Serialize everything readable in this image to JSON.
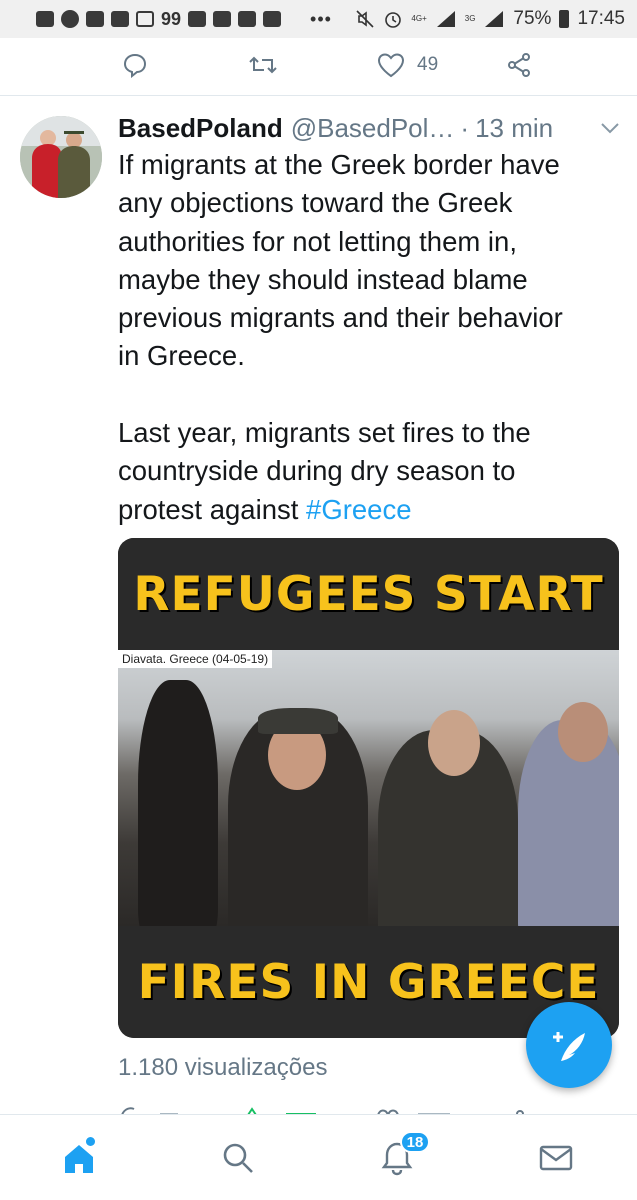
{
  "status_bar": {
    "notif_count": "99",
    "dots": "•••",
    "battery": "75%",
    "time": "17:45",
    "network_1": "4G+",
    "network_2": "3G"
  },
  "prev_tweet_actions": {
    "likes": "49"
  },
  "tweet": {
    "name": "BasedPoland",
    "handle": "@BasedPol…",
    "separator": "·",
    "time": "13 min",
    "lines_p1": [
      "If migrants at the Greek border have",
      "any objections toward the Greek",
      "authorities for not letting them in,",
      "maybe they should instead blame",
      "previous migrants and their behavior",
      "in Greece."
    ],
    "lines_p2": [
      "Last year, migrants set fires to the",
      "countryside during dry season to"
    ],
    "last_line_text": "protest against ",
    "hashtag": "#Greece",
    "media": {
      "caption_top": "REFUGEES START",
      "caption_bottom": "FIRES IN GREECE",
      "stamp": "Diavata. Greece (04-05-19)"
    },
    "views": "1.180 visualizações"
  },
  "bottom_nav": {
    "notif_badge": "18"
  },
  "colors": {
    "accent": "#1da1f2",
    "text": "#14171a",
    "muted": "#657786",
    "caption": "#f7c21c"
  },
  "icons": [
    "message-icon",
    "whatsapp-icon",
    "youtube-icon",
    "mute-icon",
    "alarm-icon",
    "signal-icon",
    "battery-icon",
    "reply-icon",
    "retweet-icon",
    "heart-icon",
    "share-icon",
    "chevron-down-icon",
    "compose-icon",
    "home-icon",
    "search-icon",
    "bell-icon",
    "mail-icon"
  ]
}
